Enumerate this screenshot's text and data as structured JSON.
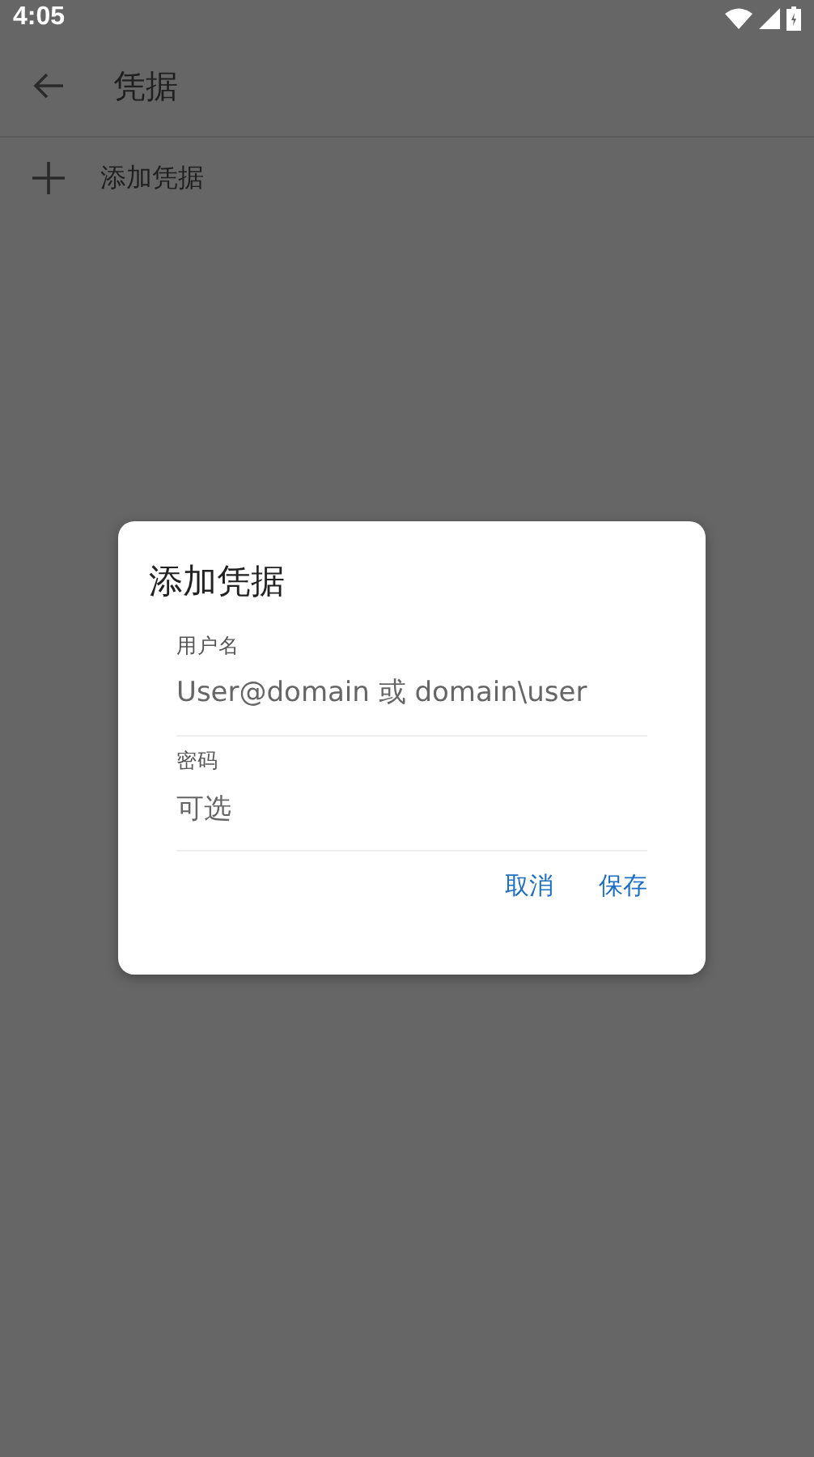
{
  "status_bar": {
    "time": "4:05"
  },
  "toolbar": {
    "title": "凭据"
  },
  "list": [
    {
      "label": "添加凭据"
    }
  ],
  "dialog": {
    "title": "添加凭据",
    "fields": [
      {
        "label": "用户名",
        "placeholder": "User@domain 或 domain\\user"
      },
      {
        "label": "密码",
        "placeholder": "可选"
      }
    ],
    "buttons": [
      "取消",
      "保存"
    ]
  }
}
